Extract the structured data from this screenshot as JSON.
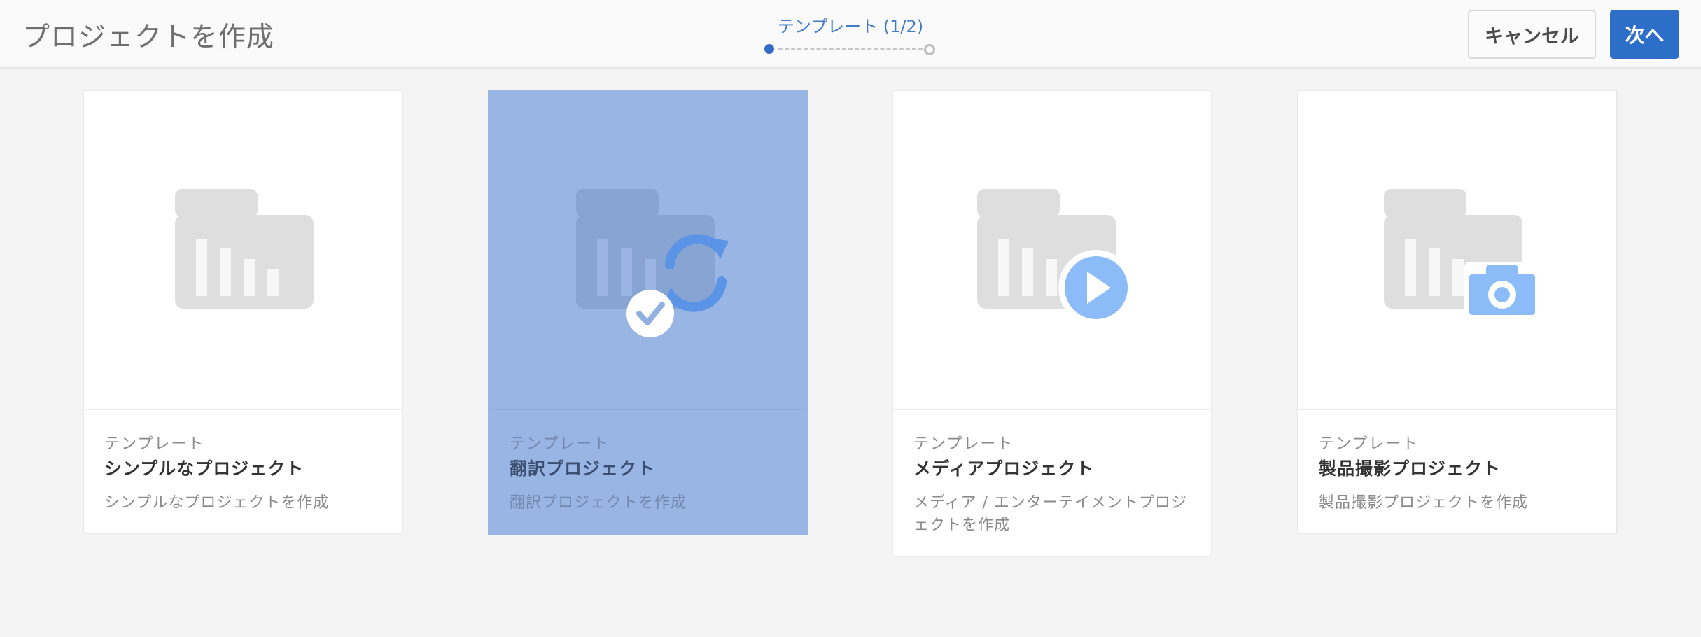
{
  "header": {
    "title": "プロジェクトを作成",
    "step_label": "テンプレート (1/2)",
    "cancel_label": "キャンセル",
    "next_label": "次へ"
  },
  "templates": [
    {
      "kicker": "テンプレート",
      "title": "シンプルなプロジェクト",
      "description": "シンプルなプロジェクトを作成",
      "icon": "folder-chart-icon",
      "selected": false
    },
    {
      "kicker": "テンプレート",
      "title": "翻訳プロジェクト",
      "description": "翻訳プロジェクトを作成",
      "icon": "translation-sync-icon",
      "selected": true
    },
    {
      "kicker": "テンプレート",
      "title": "メディアプロジェクト",
      "description": "メディア / エンターテイメントプロジェクトを作成",
      "icon": "play-icon",
      "selected": false
    },
    {
      "kicker": "テンプレート",
      "title": "製品撮影プロジェクト",
      "description": "製品撮影プロジェクトを作成",
      "icon": "camera-icon",
      "selected": false
    }
  ],
  "colors": {
    "accent": "#2d6ec8",
    "selected_card": "#98b5e3",
    "icon_blue": "#8cbcf7"
  }
}
